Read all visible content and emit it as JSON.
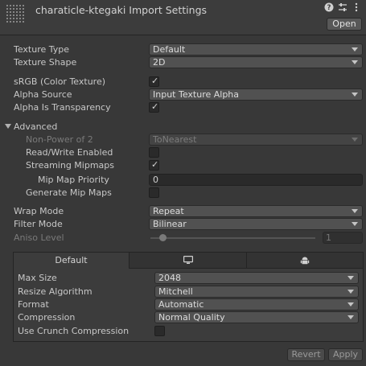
{
  "header": {
    "title": "charaticle-ktegaki Import Settings",
    "open_label": "Open",
    "icons": [
      "help-icon",
      "settings-sliders-icon",
      "more-vertical-icon"
    ]
  },
  "texture_type": {
    "label": "Texture Type",
    "value": "Default"
  },
  "texture_shape": {
    "label": "Texture Shape",
    "value": "2D"
  },
  "srgb": {
    "label": "sRGB (Color Texture)",
    "checked": true
  },
  "alpha_source": {
    "label": "Alpha Source",
    "value": "Input Texture Alpha"
  },
  "alpha_transparency": {
    "label": "Alpha Is Transparency",
    "checked": true
  },
  "advanced": {
    "label": "Advanced",
    "expanded": true,
    "non_power_of_2": {
      "label": "Non-Power of 2",
      "value": "ToNearest",
      "enabled": false
    },
    "read_write": {
      "label": "Read/Write Enabled",
      "checked": false
    },
    "streaming_mipmaps": {
      "label": "Streaming Mipmaps",
      "checked": true
    },
    "mip_map_priority": {
      "label": "Mip Map Priority",
      "value": "0"
    },
    "generate_mip_maps": {
      "label": "Generate Mip Maps",
      "checked": false
    }
  },
  "wrap_mode": {
    "label": "Wrap Mode",
    "value": "Repeat"
  },
  "filter_mode": {
    "label": "Filter Mode",
    "value": "Bilinear"
  },
  "aniso_level": {
    "label": "Aniso Level",
    "value": "1",
    "enabled": false
  },
  "platform": {
    "tabs": [
      {
        "label": "Default",
        "icon": null,
        "active": true
      },
      {
        "label": "",
        "icon": "monitor-icon",
        "active": false
      },
      {
        "label": "",
        "icon": "android-icon",
        "active": false
      }
    ],
    "max_size": {
      "label": "Max Size",
      "value": "2048"
    },
    "resize_algorithm": {
      "label": "Resize Algorithm",
      "value": "Mitchell"
    },
    "format": {
      "label": "Format",
      "value": "Automatic"
    },
    "compression": {
      "label": "Compression",
      "value": "Normal Quality"
    },
    "crunch": {
      "label": "Use Crunch Compression",
      "checked": false
    }
  },
  "footer": {
    "revert_label": "Revert",
    "apply_label": "Apply"
  }
}
